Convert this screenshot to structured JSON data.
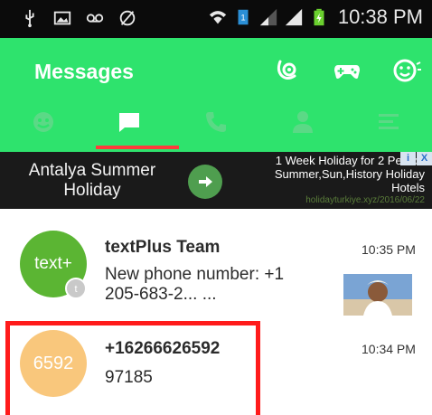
{
  "status_bar": {
    "time": "10:38 PM",
    "icons": [
      "usb-icon",
      "image-icon",
      "voicemail-icon",
      "no-sync-icon",
      "wifi-icon",
      "sim-icon",
      "signal-icon",
      "signal-icon",
      "battery-charging-icon"
    ]
  },
  "app_bar": {
    "title": "Messages",
    "actions": [
      "sticker-icon",
      "gamepad-icon",
      "emoji-icon"
    ],
    "tabs": [
      {
        "icon": "smiley-icon",
        "selected": false
      },
      {
        "icon": "chat-bubble-icon",
        "selected": true
      },
      {
        "icon": "phone-icon",
        "selected": false
      },
      {
        "icon": "person-icon",
        "selected": false
      },
      {
        "icon": "menu-icon",
        "selected": false
      }
    ],
    "colors": {
      "background": "#2ee36d",
      "tab_indicator": "#ff3b3b"
    }
  },
  "ad": {
    "left_text": "Antalya Summer Holiday",
    "right_line1": "1 Week Holiday for 2 Person",
    "right_line2": "Summer,Sun,History Holiday",
    "right_line3": "Hotels",
    "url": "holidayturkiye.xyz/2016/06/22",
    "info_glyph": "i",
    "close_glyph": "X"
  },
  "conversations": [
    {
      "avatar_text": "text+",
      "avatar_color": "#5bb533",
      "name": "textPlus Team",
      "preview_line1": "New phone number: +1",
      "preview_line2": "205-683-2... ...",
      "time": "10:35 PM",
      "has_photo": true
    },
    {
      "avatar_text": "6592",
      "avatar_color": "#f9c77c",
      "name": "+16266626592",
      "preview_line1": "97185",
      "time": "10:34 PM",
      "highlighted": true
    }
  ]
}
